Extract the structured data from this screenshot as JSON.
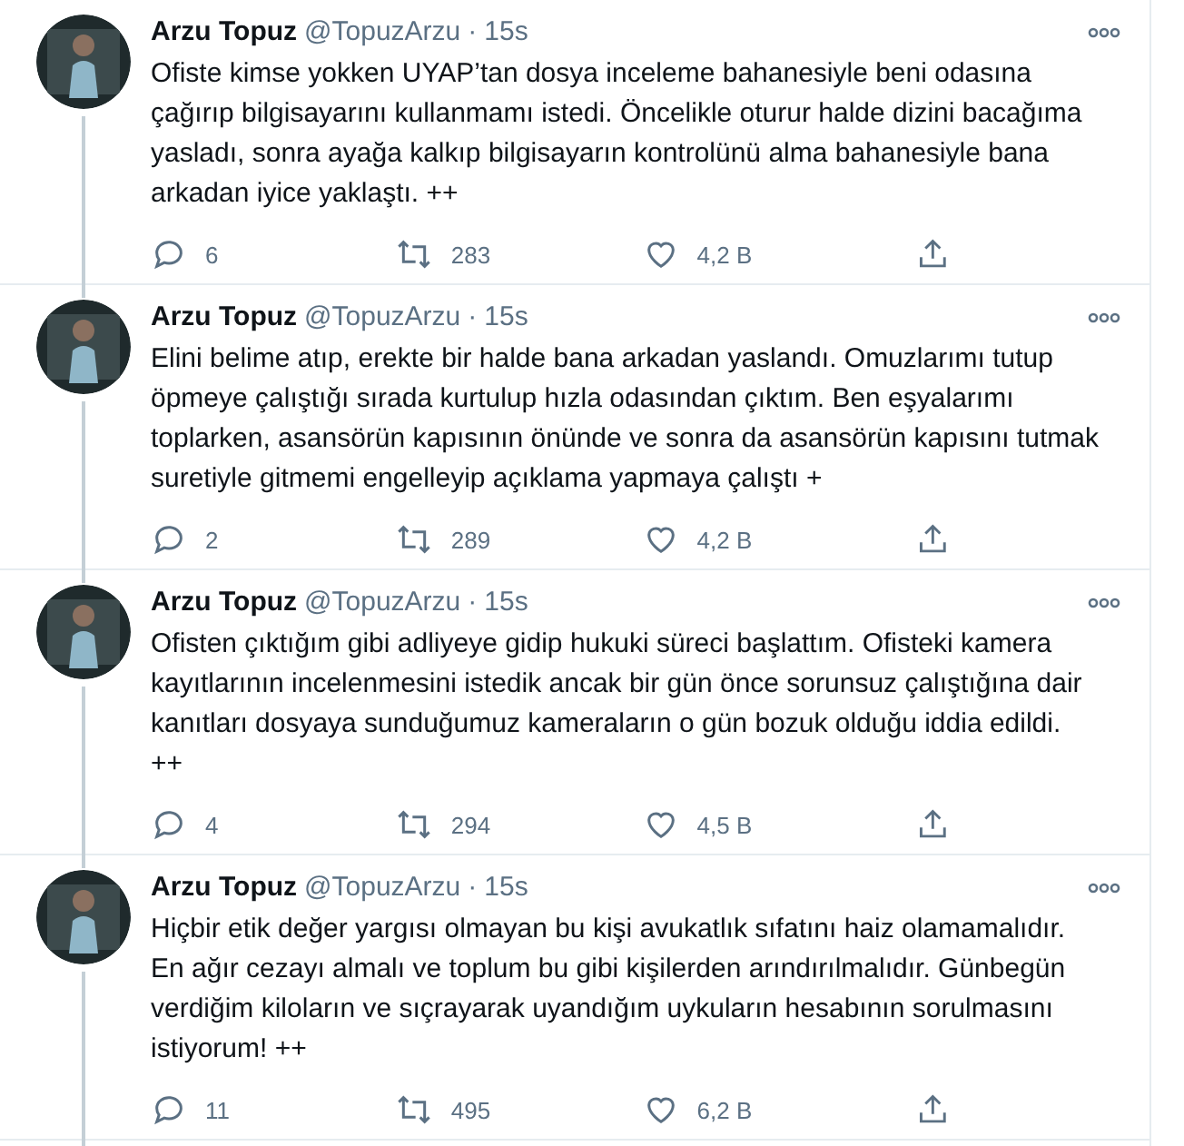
{
  "tweets": [
    {
      "name": "Arzu Topuz",
      "handle": "@TopuzArzu",
      "separator": "·",
      "time": "15s",
      "text": "Ofiste kimse yokken UYAP’tan dosya inceleme bahanesiyle  beni odasına çağırıp bilgisayarını kullanmamı istedi. Öncelikle oturur halde dizini bacağıma yasladı, sonra ayağa kalkıp bilgisayarın kontrolünü alma bahanesiyle bana arkadan iyice yaklaştı. ++",
      "replies": "6",
      "retweets": "283",
      "likes": "4,2 B"
    },
    {
      "name": "Arzu Topuz",
      "handle": "@TopuzArzu",
      "separator": "·",
      "time": "15s",
      "text": "Elini belime atıp, erekte bir halde bana arkadan yaslandı. Omuzlarımı tutup öpmeye çalıştığı sırada kurtulup hızla odasından çıktım.  Ben eşyalarımı toplarken, asansörün kapısının önünde ve sonra da asansörün kapısını tutmak suretiyle gitmemi engelleyip açıklama yapmaya çalıştı +",
      "replies": "2",
      "retweets": "289",
      "likes": "4,2 B"
    },
    {
      "name": "Arzu Topuz",
      "handle": "@TopuzArzu",
      "separator": "·",
      "time": "15s",
      "text": "Ofisten çıktığım gibi adliyeye gidip hukuki süreci başlattım.  Ofisteki kamera kayıtlarının incelenmesini istedik ancak bir gün önce sorunsuz çalıştığına dair kanıtları dosyaya sunduğumuz kameraların o gün bozuk olduğu iddia edildi. ++",
      "replies": "4",
      "retweets": "294",
      "likes": "4,5 B"
    },
    {
      "name": "Arzu Topuz",
      "handle": "@TopuzArzu",
      "separator": "·",
      "time": "15s",
      "text": "Hiçbir etik değer yargısı olmayan bu kişi avukatlık sıfatını haiz olamamalıdır. En ağır cezayı almalı ve toplum bu gibi kişilerden arındırılmalıdır. Günbegün verdiğim kiloların ve sıçrayarak uyandığım uykuların hesabının sorulmasını istiyorum! ++",
      "replies": "11",
      "retweets": "495",
      "likes": "6,2 B"
    }
  ]
}
